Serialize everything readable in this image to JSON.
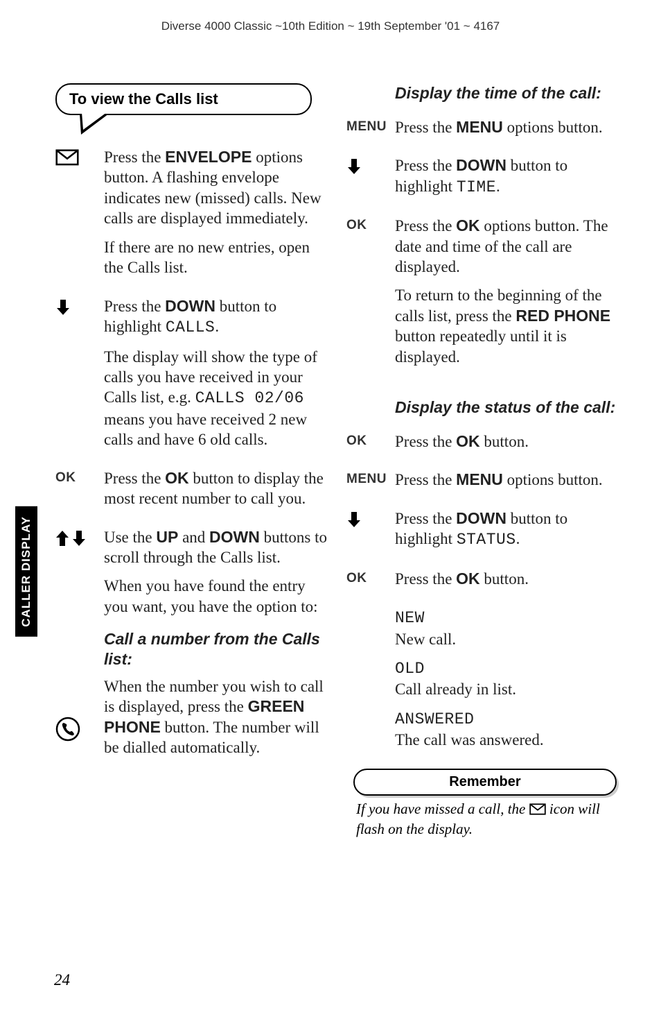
{
  "header": "Diverse 4000 Classic ~10th Edition ~ 19th September '01 ~ 4167",
  "sidetab": "CALLER DISPLAY",
  "pagenum": "24",
  "left": {
    "bubble": "To view the Calls list",
    "s1_a": "Press the ",
    "s1_b": "ENVELOPE",
    "s1_c": " options button. A flashing envelope indicates new (missed) calls. New calls are displayed immediately.",
    "s1_d": "If there are no new entries, open the Calls list.",
    "s2_a": "Press the ",
    "s2_b": "DOWN",
    "s2_c": " button to highlight ",
    "s2_d": "CALLS",
    "s2_e": ".",
    "s2_f": "The display will show the type of calls you have received in your Calls list, e.g. ",
    "s2_g": "CALLS 02/06",
    "s2_h": " means you have received 2 new calls and have 6 old calls.",
    "s3_lbl": "OK",
    "s3_a": "Press the ",
    "s3_b": "OK",
    "s3_c": " button to display the most recent number to call you.",
    "s4_a": "Use the ",
    "s4_b": "UP",
    "s4_c": " and ",
    "s4_d": "DOWN",
    "s4_e": " buttons to scroll through the Calls list.",
    "s4_f": "When you have found the entry you want, you have the option to:",
    "sub1": "Call a number from the Calls list:",
    "s5_a": "When the number you wish to call is displayed, press the ",
    "s5_b": "GREEN PHONE",
    "s5_c": " button. The number will be dialled automatically."
  },
  "right": {
    "sub1": "Display the time of the call:",
    "r1_lbl": "MENU",
    "r1_a": "Press the ",
    "r1_b": "MENU",
    "r1_c": " options button.",
    "r2_a": "Press the ",
    "r2_b": "DOWN",
    "r2_c": " button to highlight ",
    "r2_d": "TIME",
    "r2_e": ".",
    "r3_lbl": "OK",
    "r3_a": "Press the ",
    "r3_b": "OK",
    "r3_c": " options button. The date and time of the call are displayed.",
    "r3_d": "To return to the beginning of the calls list, press the ",
    "r3_e": "RED PHONE",
    "r3_f": " button repeatedly until it is displayed.",
    "sub2": "Display the status of the call:",
    "r4_lbl": "OK",
    "r4_a": "Press the ",
    "r4_b": "OK",
    "r4_c": " button.",
    "r5_lbl": "MENU",
    "r5_a": "Press the ",
    "r5_b": "MENU",
    "r5_c": " options button.",
    "r6_a": "Press the ",
    "r6_b": "DOWN",
    "r6_c": " button to highlight ",
    "r6_d": "STATUS",
    "r6_e": ".",
    "r7_lbl": "OK",
    "r7_a": "Press the ",
    "r7_b": "OK",
    "r7_c": " button.",
    "r8_a": "NEW",
    "r8_b": "New call.",
    "r9_a": "OLD",
    "r9_b": "Call already in list.",
    "r10_a": "ANSWERED",
    "r10_b": "The call was answered.",
    "remember": "Remember",
    "note_a": "If you have missed a call, the ",
    "note_b": " icon will flash on the display."
  }
}
